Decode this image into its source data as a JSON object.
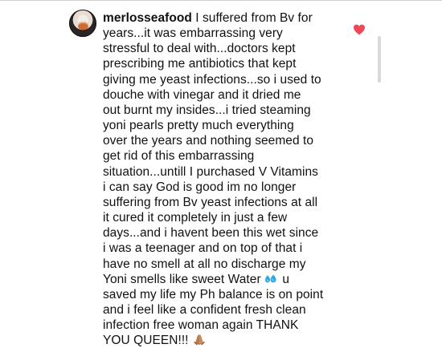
{
  "comment": {
    "username": "merlosseafood",
    "lines": [
      "I suffered from Bv for",
      "years...it was embarrassing very",
      "stressful to deal with...doctors kept",
      "prescribing me antibiotics that kept",
      "giving me yeast infections...so i used to",
      "douche with vinegar and it dried me",
      "out burnt my insides...i tried steaming",
      "yoni pearls pretty much everything",
      "over the years and nothing seemed to",
      "get rid of this embarrassing",
      "situation...untill I purchased V Vitamins",
      "i can say God is good im no longer",
      "suffering from Bv yeast infections at all",
      "it cured it completely in just a few",
      "days...and i havent been this wet since",
      "i was a teenager and on top of that i",
      "have no smell at all no discharge my",
      "Yoni smells like sweet Water",
      "u",
      "saved my life my Ph balance is on point",
      "and i feel like a confident fresh clean",
      "infection free woman again THANK",
      "YOU QUEEN!!!"
    ]
  },
  "icons": {
    "heart": "heart-icon",
    "avatar": "avatar-seafood-photo",
    "water_emoji": "sweat-droplets-icon",
    "hands_emoji": "folded-hands-icon"
  },
  "colors": {
    "text": "#111111",
    "heart": "#ed4956",
    "water": "#2aa7e8",
    "hands": "#b97a4f",
    "background": "#ffffff"
  }
}
